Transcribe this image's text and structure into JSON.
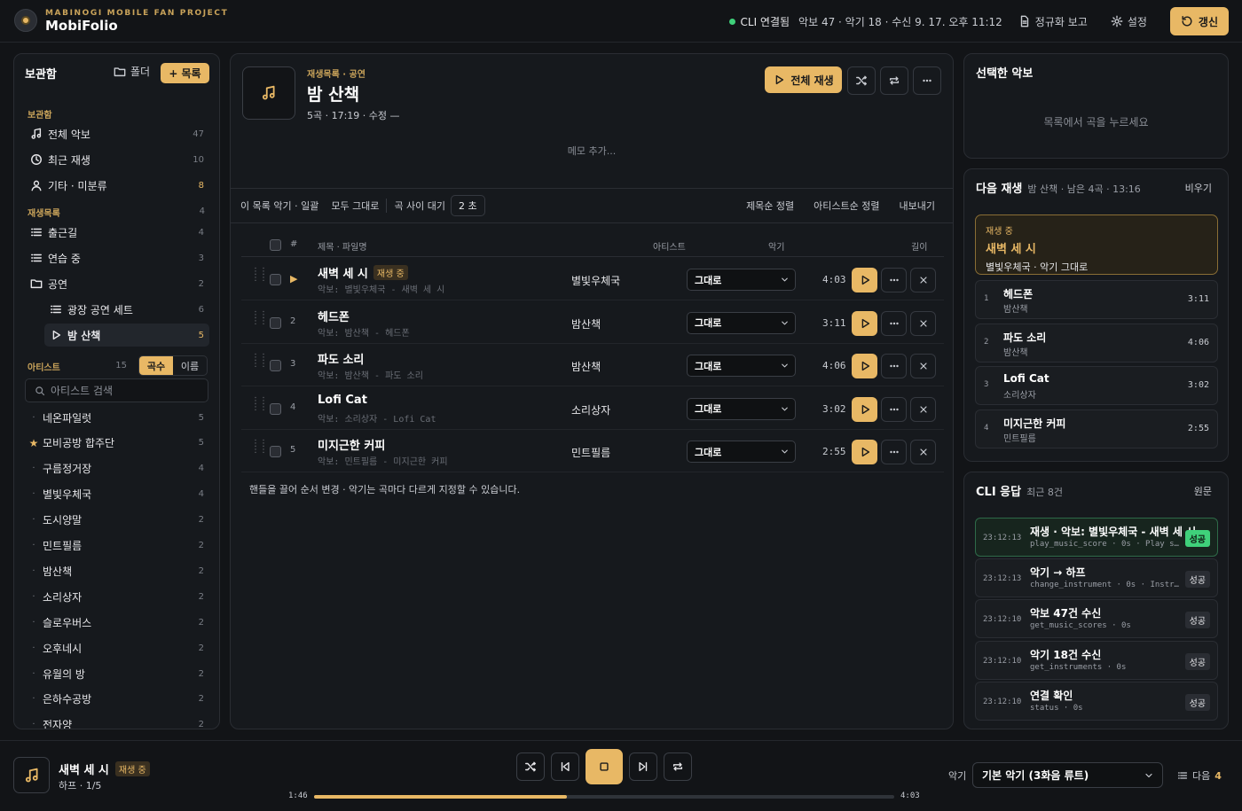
{
  "app": {
    "subtitle": "MABINOGI MOBILE FAN PROJECT",
    "title": "MobiFolio"
  },
  "header": {
    "status": "CLI 연결됨",
    "stats": "악보 47 · 악기 18 · 수신 9. 17. 오후 11:12",
    "normalize_report": "정규화 보고",
    "settings": "설정",
    "refresh": "갱신"
  },
  "sidebar": {
    "title": "보관함",
    "folder_btn": "폴더",
    "new_btn": "목록",
    "library_section": "보관함",
    "library": [
      {
        "label": "전체 악보",
        "count": "47",
        "icon": "music-icon"
      },
      {
        "label": "최근 재생",
        "count": "10",
        "icon": "clock-icon"
      },
      {
        "label": "기타 · 미분류",
        "count": "8",
        "icon": "user-icon"
      }
    ],
    "playlists_section": "재생목록",
    "playlists_count": "4",
    "playlists": [
      {
        "label": "출근길",
        "count": "4"
      },
      {
        "label": "연습 중",
        "count": "3"
      },
      {
        "label": "공연",
        "count": "2"
      },
      {
        "label": "광장 공연 세트",
        "count": "6"
      },
      {
        "label": "밤 산책",
        "count": "5"
      }
    ],
    "artists_section": "아티스트",
    "artists_count": "15",
    "sort_count": "곡수",
    "sort_name": "이름",
    "search_placeholder": "아티스트 검색",
    "artists": [
      {
        "name": "네온파일럿",
        "count": "5"
      },
      {
        "name": "모비공방 합주단",
        "count": "5"
      },
      {
        "name": "구름정거장",
        "count": "4"
      },
      {
        "name": "별빛우체국",
        "count": "4"
      },
      {
        "name": "도시양말",
        "count": "2"
      },
      {
        "name": "민트필름",
        "count": "2"
      },
      {
        "name": "밤산책",
        "count": "2"
      },
      {
        "name": "소리상자",
        "count": "2"
      },
      {
        "name": "슬로우버스",
        "count": "2"
      },
      {
        "name": "오후네시",
        "count": "2"
      },
      {
        "name": "유월의 방",
        "count": "2"
      },
      {
        "name": "은하수공방",
        "count": "2"
      },
      {
        "name": "전자양",
        "count": "2"
      }
    ]
  },
  "playlist": {
    "crumb": "재생목록 · 공연",
    "title": "밤 산책",
    "meta": "5곡 · 17:19 · 수정 —",
    "play_all": "전체 재생",
    "memo_placeholder": "메모 추가...",
    "toolbar": {
      "bulk": "이 목록 악기 · 일괄",
      "all_default": "모두 그대로",
      "gap_label": "곡 사이 대기",
      "gap_value": "2 초",
      "sort_title": "제목순 정렬",
      "sort_artist": "아티스트순 정렬",
      "export": "내보내기"
    },
    "columns": {
      "num": "#",
      "title": "제목 · 파일명",
      "artist": "아티스트",
      "instrument": "악기",
      "length": "길이"
    },
    "playing_badge": "재생 중",
    "tracks": [
      {
        "num": "1",
        "title": "새벽 세 시",
        "file": "악보: 별빛우체국 - 새벽 세 시",
        "artist": "별빛우체국",
        "instrument": "그대로",
        "length": "4:03"
      },
      {
        "num": "2",
        "title": "헤드폰",
        "file": "악보: 밤산책 - 헤드폰",
        "artist": "밤산책",
        "instrument": "그대로",
        "length": "3:11"
      },
      {
        "num": "3",
        "title": "파도 소리",
        "file": "악보: 밤산책 - 파도 소리",
        "artist": "밤산책",
        "instrument": "그대로",
        "length": "4:06"
      },
      {
        "num": "4",
        "title": "Lofi Cat",
        "file": "악보: 소리상자 - Lofi Cat",
        "artist": "소리상자",
        "instrument": "그대로",
        "length": "3:02"
      },
      {
        "num": "5",
        "title": "미지근한 커피",
        "file": "악보: 민트필름 - 미지근한 커피",
        "artist": "민트필름",
        "instrument": "그대로",
        "length": "2:55"
      }
    ],
    "hint": "핸들을 끌어 순서 변경 · 악기는 곡마다 다르게 지정할 수 있습니다."
  },
  "selected": {
    "title": "선택한 악보",
    "empty": "목록에서 곡을 누르세요"
  },
  "queue": {
    "title": "다음 재생",
    "sub": "밤 산책 · 남은 4곡 · 13:16",
    "clear": "비우기",
    "now_label": "재생 중",
    "now_title": "새벽 세 시",
    "now_sub": "별빛우체국 · 악기 그대로",
    "items": [
      {
        "num": "1",
        "title": "헤드폰",
        "artist": "밤산책",
        "length": "3:11"
      },
      {
        "num": "2",
        "title": "파도 소리",
        "artist": "밤산책",
        "length": "4:06"
      },
      {
        "num": "3",
        "title": "Lofi Cat",
        "artist": "소리상자",
        "length": "3:02"
      },
      {
        "num": "4",
        "title": "미지근한 커피",
        "artist": "민트필름",
        "length": "2:55"
      }
    ]
  },
  "cli": {
    "title": "CLI 응답",
    "sub": "최근 8건",
    "raw": "원문",
    "items": [
      {
        "time": "23:12:13",
        "title": "재생 · 악보: 별빛우체국 - 새벽 세 시",
        "sub": "play_music_score · 0s · Play s…",
        "status": "성공"
      },
      {
        "time": "23:12:13",
        "title": "악기 → 하프",
        "sub": "change_instrument · 0s · Instr…",
        "status": "성공"
      },
      {
        "time": "23:12:10",
        "title": "악보 47건 수신",
        "sub": "get_music_scores · 0s",
        "status": "성공"
      },
      {
        "time": "23:12:10",
        "title": "악기 18건 수신",
        "sub": "get_instruments · 0s",
        "status": "성공"
      },
      {
        "time": "23:12:10",
        "title": "연결 확인",
        "sub": "status · 0s",
        "status": "성공"
      }
    ]
  },
  "player": {
    "title": "새벽 세 시",
    "badge": "재생 중",
    "sub": "하프 · 1/5",
    "current": "1:46",
    "total": "4:03",
    "progress": 0.436,
    "instrument_label": "악기",
    "instrument": "기본 악기 (3화음 류트)",
    "next_label": "다음",
    "next_count": "4"
  },
  "colors": {
    "accent": "#e8b865",
    "success": "#3fd07a",
    "background": "#121417",
    "panel": "#16191d"
  }
}
